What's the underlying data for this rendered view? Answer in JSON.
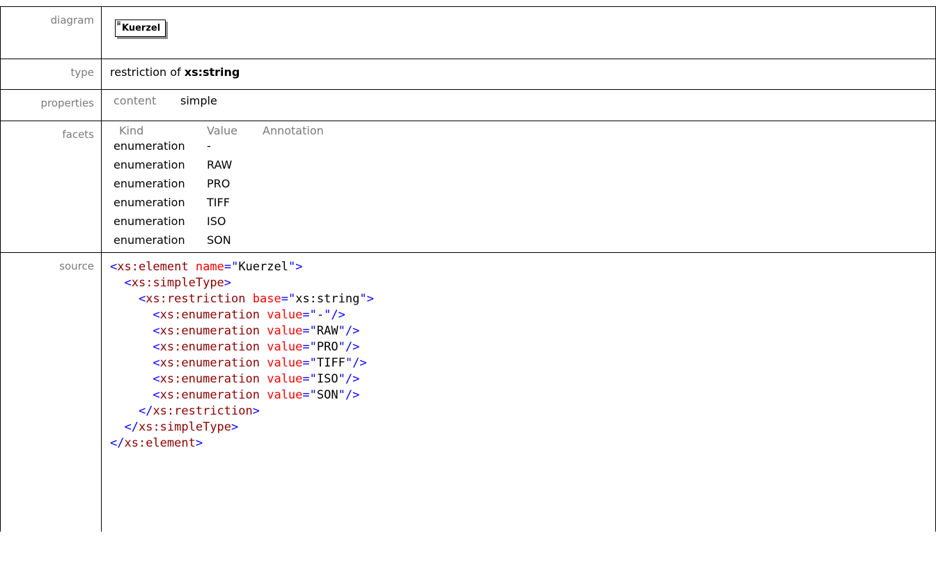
{
  "labels": {
    "diagram": "diagram",
    "type": "type",
    "properties": "properties",
    "facets": "facets",
    "source": "source"
  },
  "diagram": {
    "element_name": "Kuerzel"
  },
  "type": {
    "prefix": "restriction of ",
    "base": "xs:string"
  },
  "properties": {
    "name": "content",
    "value": "simple"
  },
  "facets": {
    "headers": {
      "kind": "Kind",
      "value": "Value",
      "annotation": "Annotation"
    },
    "rows": [
      {
        "kind": "enumeration",
        "value": "-"
      },
      {
        "kind": "enumeration",
        "value": "RAW"
      },
      {
        "kind": "enumeration",
        "value": "PRO"
      },
      {
        "kind": "enumeration",
        "value": "TIFF"
      },
      {
        "kind": "enumeration",
        "value": "ISO"
      },
      {
        "kind": "enumeration",
        "value": "SON"
      }
    ]
  },
  "source": {
    "element_tag": "xs:element",
    "element_attr": "name",
    "element_value": "Kuerzel",
    "simpletype_tag": "xs:simpleType",
    "restriction_tag": "xs:restriction",
    "restriction_attr": "base",
    "restriction_value": "xs:string",
    "enum_tag": "xs:enumeration",
    "enum_attr": "value",
    "enum_values": [
      "-",
      "RAW",
      "PRO",
      "TIFF",
      "ISO",
      "SON"
    ]
  },
  "colors": {
    "tag": "#8b0000",
    "bracket": "#0000ff",
    "attribute": "#ff0000",
    "label": "#7a7a7a"
  }
}
